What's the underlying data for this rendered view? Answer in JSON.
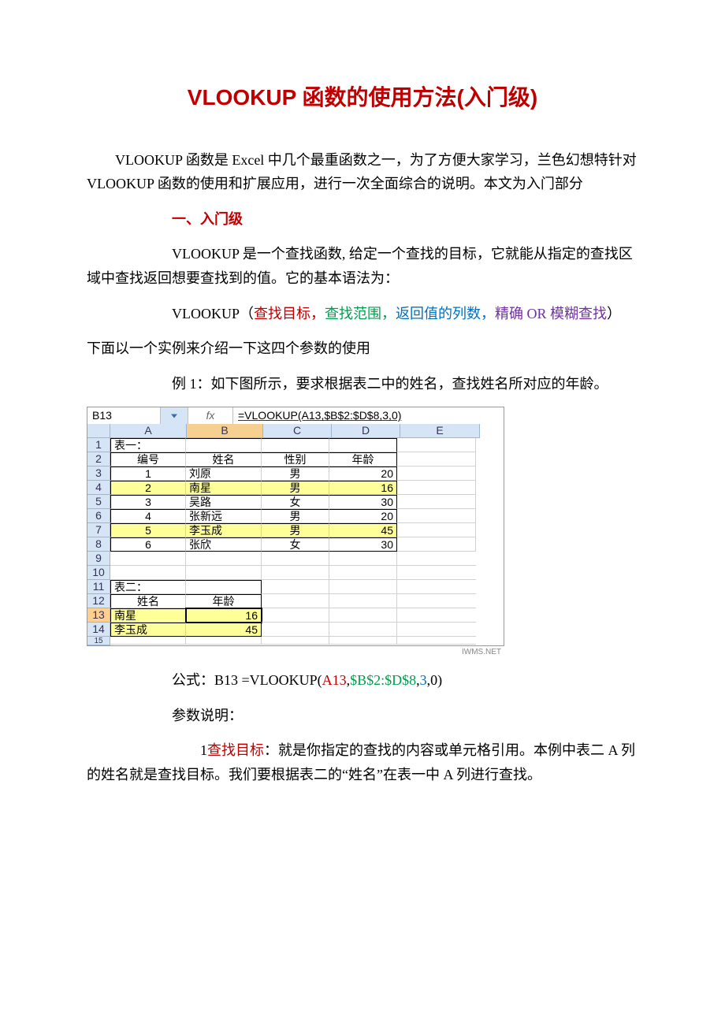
{
  "title": "VLOOKUP 函数的使用方法(入门级)",
  "intro": "VLOOKUP 函数是 Excel 中几个最重函数之一，为了方便大家学习，兰色幻想特针对 VLOOKUP 函数的使用和扩展应用，进行一次全面综合的说明。本文为入门部分",
  "section1": "一、入门级",
  "p1": "VLOOKUP 是一个查找函数, 给定一个查找的目标，它就能从指定的查找区域中查找返回想要查找到的值。它的基本语法为：",
  "syntax": {
    "prefix": "VLOOKUP（",
    "a1": "查找目标，",
    "a2": "查找范围，",
    "a3": "返回值的列数，",
    "a4": "精确 OR 模糊查找",
    "suffix": "）"
  },
  "p2": "下面以一个实例来介绍一下这四个参数的使用",
  "example_lead": "例 1：如下图所示，要求根据表二中的姓名，查找姓名所对应的年龄。",
  "excel": {
    "name_box": "B13",
    "fx_label": "fx",
    "fx_value": "=VLOOKUP(A13,$B$2:$D$8,3,0)",
    "cols": [
      "A",
      "B",
      "C",
      "D",
      "E"
    ],
    "t1_label": "表一：",
    "t1_headers": {
      "a": "编号",
      "b": "姓名",
      "c": "性别",
      "d": "年龄"
    },
    "t1_rows": [
      {
        "no": "1",
        "name": "刘原",
        "sex": "男",
        "age": "20",
        "hl": false
      },
      {
        "no": "2",
        "name": "南星",
        "sex": "男",
        "age": "16",
        "hl": true
      },
      {
        "no": "3",
        "name": "吴路",
        "sex": "女",
        "age": "30",
        "hl": false
      },
      {
        "no": "4",
        "name": "张新远",
        "sex": "男",
        "age": "20",
        "hl": false
      },
      {
        "no": "5",
        "name": "李玉成",
        "sex": "男",
        "age": "45",
        "hl": true
      },
      {
        "no": "6",
        "name": "张欣",
        "sex": "女",
        "age": "30",
        "hl": false
      }
    ],
    "t2_label": "表二：",
    "t2_headers": {
      "a": "姓名",
      "b": "年龄"
    },
    "t2_rows": [
      {
        "name": "南星",
        "age": "16"
      },
      {
        "name": "李玉成",
        "age": "45"
      }
    ],
    "watermark": "IWMS.NET"
  },
  "formula": {
    "prefix": "公式：B13 =VLOOKUP(",
    "p1": "A13",
    "c1": ",",
    "p2": "$B$2:$D$8",
    "c2": ",",
    "p3": "3",
    "c3": ",0)"
  },
  "param_head": "参数说明：",
  "param1": {
    "num": "1",
    "label": "查找目标",
    "text": "：就是你指定的查找的内容或单元格引用。本例中表二 A 列的姓名就是查找目标。我们要根据表二的“姓名”在表一中 A 列进行查找。"
  }
}
